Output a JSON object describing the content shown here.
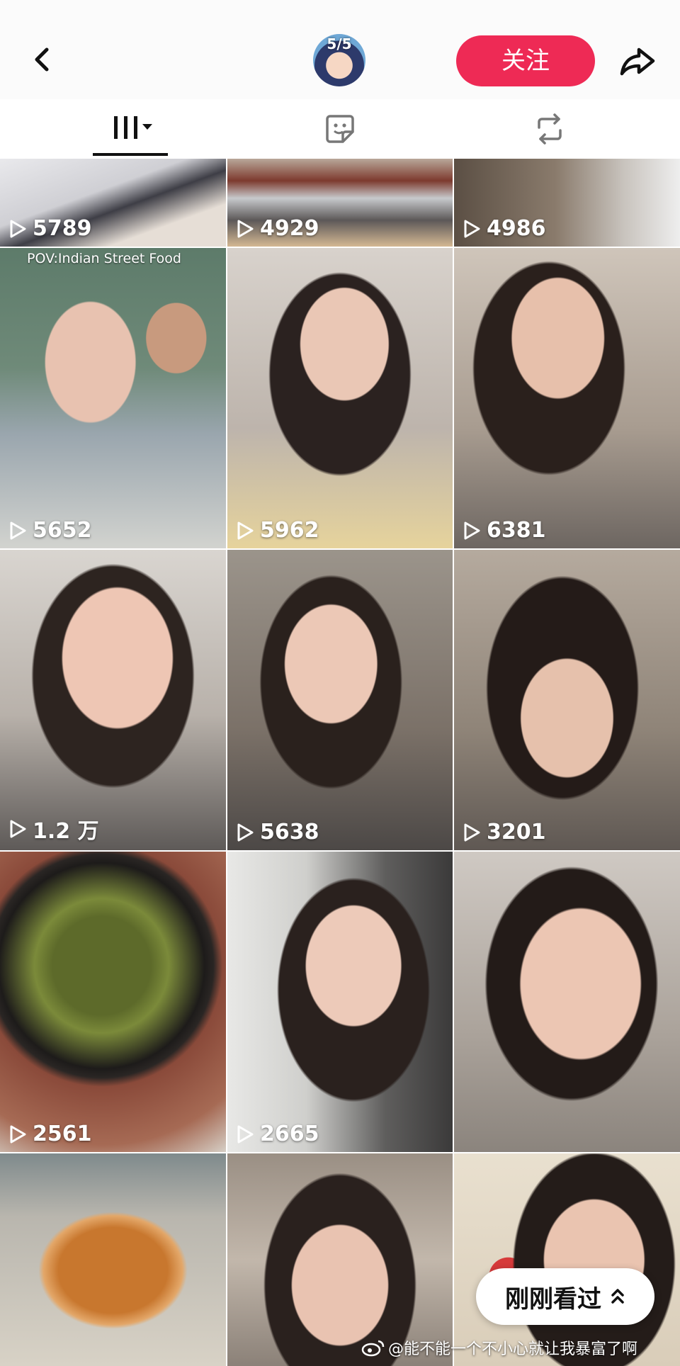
{
  "header": {
    "avatar_text": "5/5",
    "follow_label": "关注"
  },
  "tabs": [
    {
      "name": "works",
      "icon": "grid-bars-icon",
      "active": true
    },
    {
      "name": "likes",
      "icon": "sticker-icon",
      "active": false
    },
    {
      "name": "reposts",
      "icon": "repost-icon",
      "active": false
    }
  ],
  "grid": {
    "tiles": [
      {
        "count": "5789",
        "theme": "bed-arm"
      },
      {
        "count": "4929",
        "theme": "kitchen-tray"
      },
      {
        "count": "4986",
        "theme": "hallway"
      },
      {
        "count": "5652",
        "theme": "face-hands",
        "caption": "POV:Indian Street Food"
      },
      {
        "count": "5962",
        "theme": "face-chin"
      },
      {
        "count": "6381",
        "theme": "face-mouth"
      },
      {
        "count": "1.2 万",
        "theme": "face-close"
      },
      {
        "count": "5638",
        "theme": "face-wall"
      },
      {
        "count": "3201",
        "theme": "face-bun"
      },
      {
        "count": "2561",
        "theme": "soup-bowl"
      },
      {
        "count": "2665",
        "theme": "face-window"
      },
      {
        "count": "",
        "theme": "face-lips"
      },
      {
        "count": "",
        "theme": "noodles"
      },
      {
        "count": "",
        "theme": "face-room"
      },
      {
        "count": "",
        "theme": "face-strawberry"
      }
    ]
  },
  "recent": {
    "label": "刚刚看过"
  },
  "watermark": {
    "text": "@能不能一个不小心就让我暴富了啊"
  },
  "colors": {
    "accent": "#ee2a55"
  }
}
